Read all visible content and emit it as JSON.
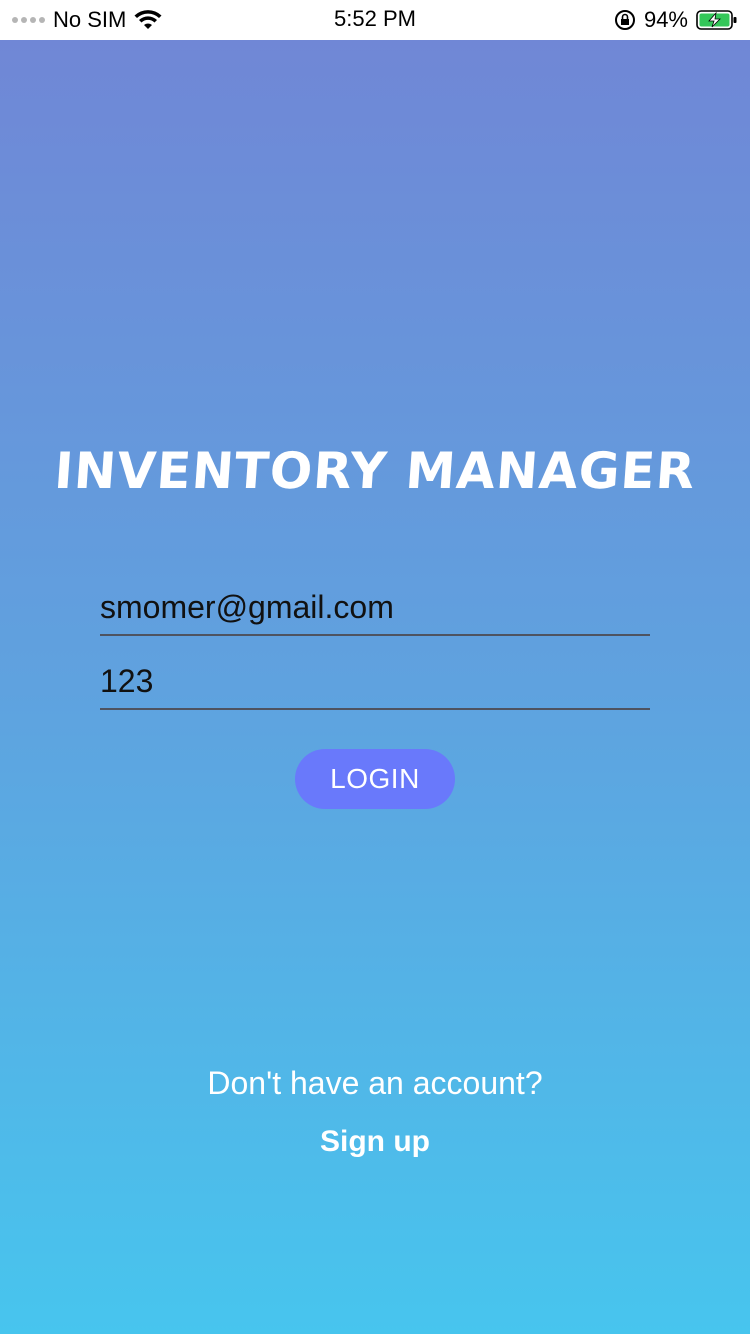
{
  "status_bar": {
    "carrier": "No SIM",
    "time": "5:52 PM",
    "battery_percent": "94%",
    "battery_level": 0.94,
    "icons": [
      "signal-dots-icon",
      "wifi-icon",
      "rotation-lock-icon",
      "battery-charging-icon"
    ]
  },
  "app": {
    "title": "INVENTORY MANAGER"
  },
  "login_form": {
    "email_value": "smomer@gmail.com",
    "password_value": "123",
    "login_label": "LOGIN"
  },
  "footer": {
    "no_account_text": "Don't have an account?",
    "signup_label": "Sign up"
  },
  "colors": {
    "gradient_top": "#7087d6",
    "gradient_bottom": "#47c5ee",
    "login_button": "#6979fb",
    "battery_green": "#34c759"
  }
}
